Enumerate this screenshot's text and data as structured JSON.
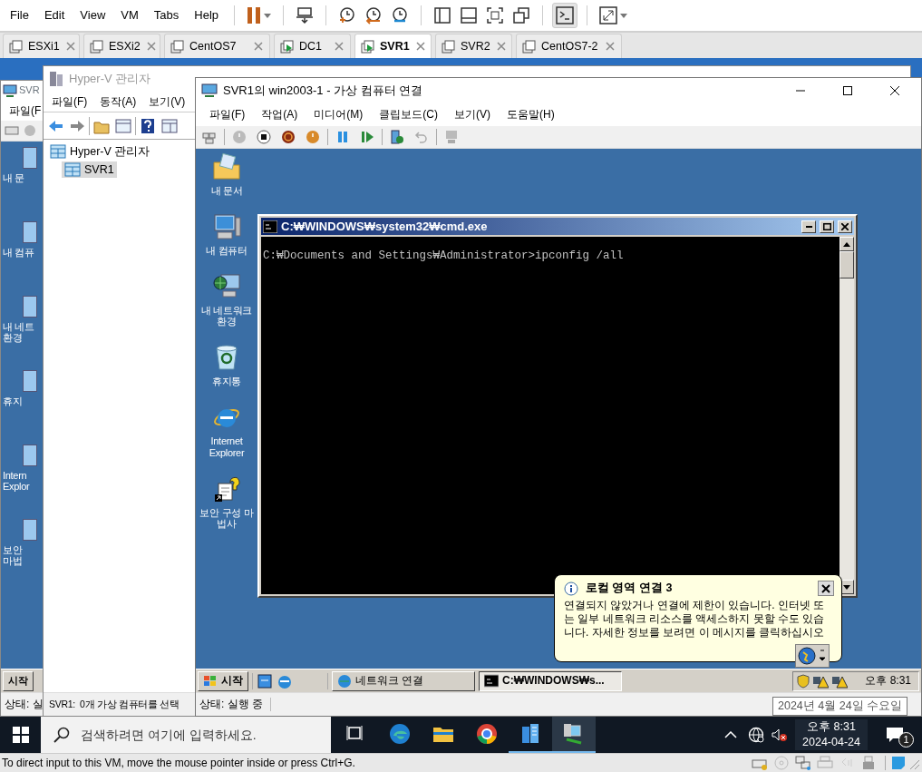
{
  "menu_bar": {
    "items": [
      "File",
      "Edit",
      "View",
      "VM",
      "Tabs",
      "Help"
    ]
  },
  "tabs": [
    {
      "label": "ESXi1",
      "running": false,
      "selected": false
    },
    {
      "label": "ESXi2",
      "running": false,
      "selected": false
    },
    {
      "label": "CentOS7",
      "running": false,
      "selected": false
    },
    {
      "label": "DC1",
      "running": true,
      "selected": false
    },
    {
      "label": "SVR1",
      "running": true,
      "selected": true
    },
    {
      "label": "SVR2",
      "running": false,
      "selected": false
    },
    {
      "label": "CentOS7-2",
      "running": false,
      "selected": false
    }
  ],
  "back_window": {
    "title": "SVR",
    "menu": [
      "파일(F"
    ],
    "desktop_labels": [
      [
        "내 문"
      ],
      [
        "내 컴퓨"
      ],
      [
        "내 네트",
        "환경"
      ],
      [
        "휴지"
      ],
      [
        "Intern",
        "Explor"
      ],
      [
        "보안",
        "마법"
      ]
    ],
    "start": "시작",
    "status": "상태: 실"
  },
  "hyperv_manager": {
    "title": "Hyper-V 관리자",
    "active": false,
    "menu": [
      "파일(F)",
      "동작(A)",
      "보기(V)"
    ],
    "tree": [
      {
        "label": "Hyper-V 관리자",
        "selected": false,
        "children": [
          {
            "label": "SVR1",
            "selected": true
          }
        ]
      }
    ],
    "status": "SVR1:  0개 가상 컴퓨터를 선택"
  },
  "vm_window": {
    "title": "SVR1의 win2003-1 - 가상 컴퓨터 연결",
    "menu": [
      "파일(F)",
      "작업(A)",
      "미디어(M)",
      "클립보드(C)",
      "보기(V)",
      "도움말(H)"
    ],
    "desktop_icons": [
      {
        "kind": "documents",
        "label": "내 문서"
      },
      {
        "kind": "computer",
        "label": "내 컴퓨터"
      },
      {
        "kind": "network",
        "label": "내 네트워크 환경"
      },
      {
        "kind": "recycle-bin",
        "label": "휴지통"
      },
      {
        "kind": "browser",
        "label": "Internet Explorer"
      },
      {
        "kind": "wizard",
        "label": "보안 구성 마법사"
      }
    ],
    "cmd_window": {
      "title": "C:₩WINDOWS₩system32₩cmd.exe",
      "lines": [
        "C:₩Documents and Settings₩Administrator>ipconfig /all"
      ]
    },
    "balloon": {
      "title": "로컬 영역 연결 3",
      "text": "연결되지 않았거나 연결에 제한이 있습니다. 인터넷 또는 일부 네트워크 리소스를 액세스하지 못할 수도 있습니다. 자세한 정보를 보려면 이 메시지를 클릭하십시오"
    },
    "taskbar": {
      "start": "시작",
      "tasks": [
        {
          "kind": "network",
          "label": "네트워크 연결",
          "selected": false
        },
        {
          "kind": "console",
          "label": "C:₩WINDOWS₩s...",
          "selected": true
        }
      ],
      "clock": "오후 8:31"
    },
    "status": "상태: 실행 중"
  },
  "tooltip": "2024년 4월 24일 수요일",
  "host_taskbar": {
    "search": {
      "placeholder": "검색하려면 여기에 입력하세요."
    },
    "apps": [
      {
        "kind": "task-view",
        "running": false,
        "selected": false
      },
      {
        "kind": "edge",
        "running": false,
        "selected": false
      },
      {
        "kind": "folder",
        "running": false,
        "selected": false
      },
      {
        "kind": "chrome",
        "running": false,
        "selected": false
      },
      {
        "kind": "server-manager",
        "running": true,
        "selected": false
      },
      {
        "kind": "vm-connect",
        "running": true,
        "selected": true
      }
    ],
    "time": "오후 8:31",
    "date": "2024-04-24",
    "notifications": "1"
  },
  "status_bar": {
    "text": "To direct input to this VM, move the mouse pointer inside or press Ctrl+G."
  }
}
